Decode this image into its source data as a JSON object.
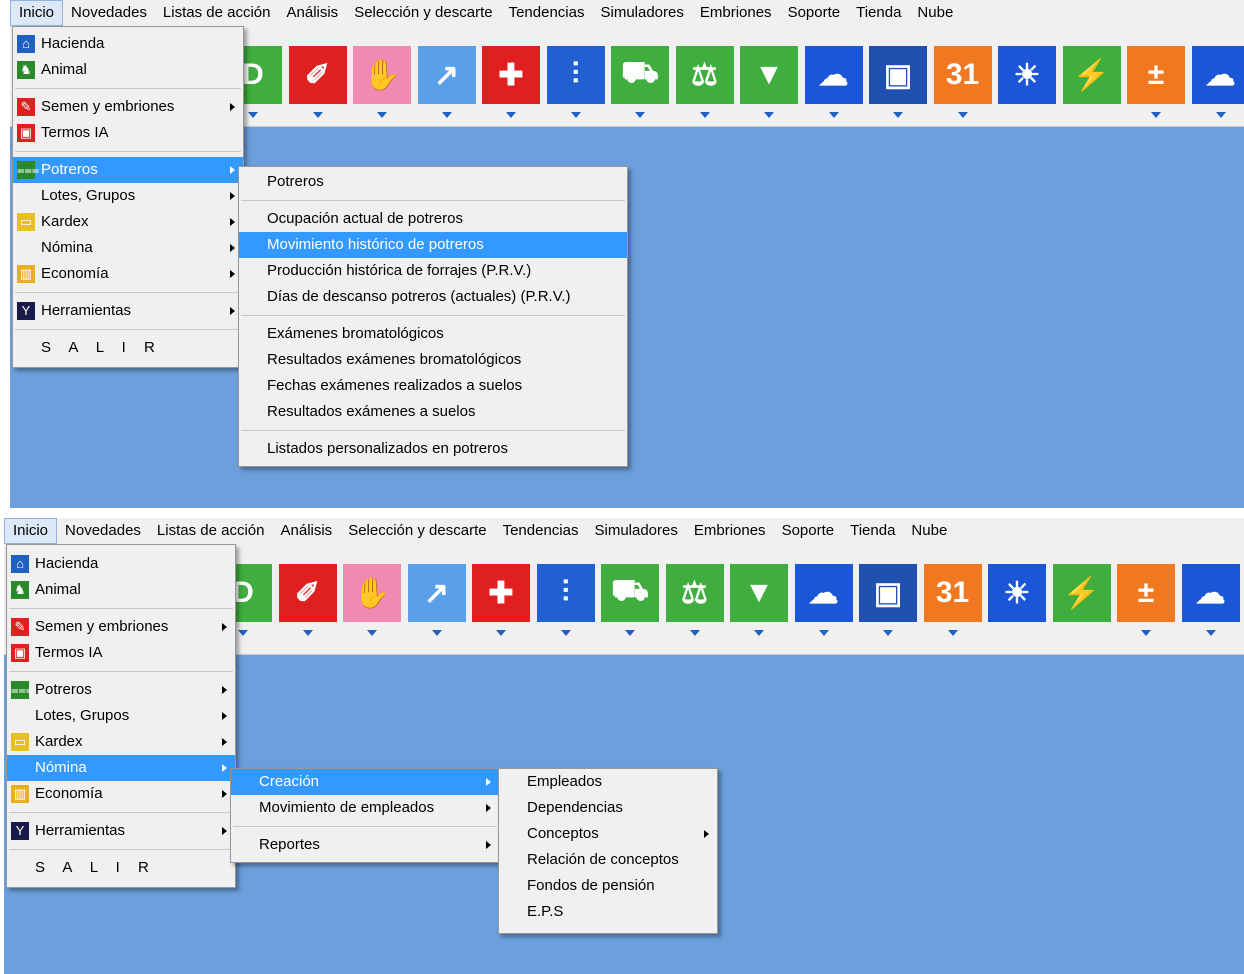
{
  "menubar": [
    "Inicio",
    "Novedades",
    "Listas de acción",
    "Análisis",
    "Selección y descarte",
    "Tendencias",
    "Simuladores",
    "Embriones",
    "Soporte",
    "Tienda",
    "Nube"
  ],
  "toolbar_icons": [
    {
      "name": "d-icon",
      "glyph": "D",
      "color": "#3fae3f"
    },
    {
      "name": "semen-icon",
      "glyph": "✐",
      "color": "#e02020"
    },
    {
      "name": "glove-icon",
      "glyph": "✋",
      "color": "#f08ab0"
    },
    {
      "name": "syringe-icon",
      "glyph": "↗",
      "color": "#5aa0e8"
    },
    {
      "name": "medical-kit-icon",
      "glyph": "✚",
      "color": "#e02020"
    },
    {
      "name": "grass-icon",
      "glyph": "⫶",
      "color": "#2060d0"
    },
    {
      "name": "truck-icon",
      "glyph": "⛟",
      "color": "#3fae3f"
    },
    {
      "name": "scale-icon",
      "glyph": "⚖",
      "color": "#3fae3f"
    },
    {
      "name": "bucket-icon",
      "glyph": "▼",
      "color": "#3fae3f"
    },
    {
      "name": "weather-icon",
      "glyph": "☁",
      "color": "#1a56d6"
    },
    {
      "name": "cow-icon",
      "glyph": "▣",
      "color": "#2050b0"
    },
    {
      "name": "calendar-icon",
      "glyph": "31",
      "color": "#f07820"
    },
    {
      "name": "lightbulb-icon",
      "glyph": "☀",
      "color": "#1a56d6"
    },
    {
      "name": "usb-icon",
      "glyph": "⚡",
      "color": "#3fae3f"
    },
    {
      "name": "calculator-icon",
      "glyph": "±",
      "color": "#f07820"
    },
    {
      "name": "cloud-upload-icon",
      "glyph": "☁",
      "color": "#1a56d6"
    }
  ],
  "main_menu": {
    "hacienda": "Hacienda",
    "animal": "Animal",
    "semen": "Semen y embriones",
    "termos": "Termos IA",
    "potreros": "Potreros",
    "lotes": "Lotes, Grupos",
    "kardex": "Kardex",
    "nomina": "Nómina",
    "economia": "Economía",
    "herramientas": "Herramientas",
    "salir": "S A L I R"
  },
  "potreros_submenu": [
    "Potreros",
    "Ocupación actual de potreros",
    "Movimiento histórico de potreros",
    "Producción histórica de forrajes (P.R.V.)",
    "Días de descanso potreros (actuales) (P.R.V.)",
    "Exámenes bromatológicos",
    "Resultados exámenes bromatológicos",
    "Fechas exámenes realizados a suelos",
    "Resultados exámenes a suelos",
    "Listados personalizados en potreros"
  ],
  "nomina_submenu": [
    "Creación",
    "Movimiento de empleados",
    "Reportes"
  ],
  "creacion_submenu": [
    "Empleados",
    "Dependencias",
    "Conceptos",
    "Relación de conceptos",
    "Fondos de pensión",
    "E.P.S"
  ],
  "colors": {
    "background": "#6ca0dc",
    "selected": "#3399ff",
    "menu": "#f0f0f0"
  }
}
